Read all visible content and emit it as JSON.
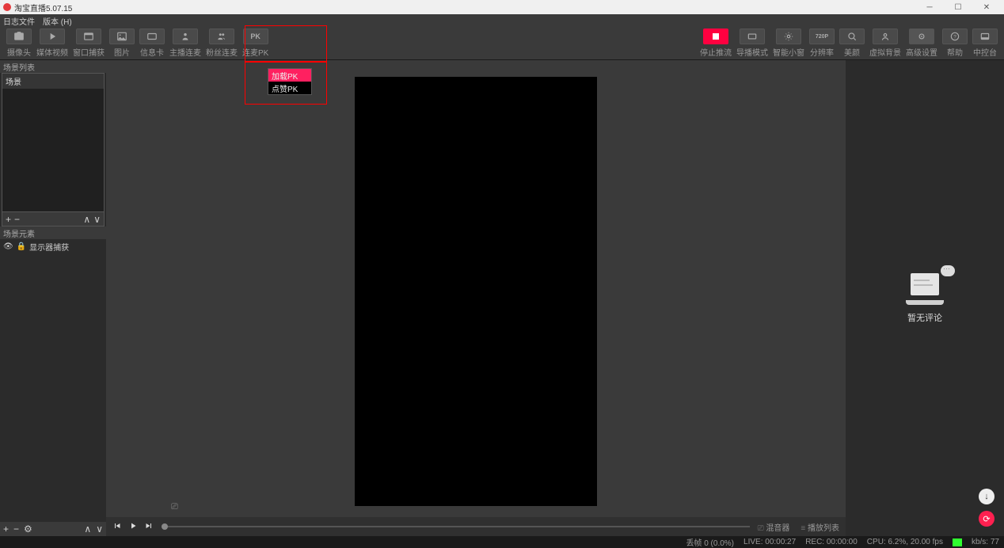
{
  "app": {
    "title": "淘宝直播5.07.15"
  },
  "menu": {
    "log_file": "日志文件",
    "ver_h": "版本 (H)"
  },
  "toolbar_left": [
    {
      "label": "摄像头",
      "icon": "camera"
    },
    {
      "label": "媒体视频",
      "icon": "play"
    },
    {
      "label": "窗口捕获",
      "icon": "window"
    },
    {
      "label": "图片",
      "icon": "image"
    },
    {
      "label": "信息卡",
      "icon": "card"
    },
    {
      "label": "主播连麦",
      "icon": "mic"
    },
    {
      "label": "粉丝连麦",
      "icon": "group"
    },
    {
      "label": "连麦PK",
      "icon": "pk",
      "text": "PK"
    }
  ],
  "pk_dropdown": {
    "item1": "加载PK",
    "item2": "点赞PK"
  },
  "toolbar_right": [
    {
      "label": "停止推流",
      "icon": "stop"
    },
    {
      "label": "导播模式",
      "icon": "director"
    },
    {
      "label": "智能小窗",
      "icon": "pip"
    },
    {
      "label": "分辨率",
      "icon": "720p",
      "text": "720P"
    },
    {
      "label": "美颜",
      "icon": "beauty"
    },
    {
      "label": "虚拟背景",
      "icon": "vbg"
    },
    {
      "label": "高级设置",
      "icon": "settings"
    },
    {
      "label": "帮助",
      "icon": "help"
    },
    {
      "label": "中控台",
      "icon": "console"
    }
  ],
  "panels": {
    "scene_list_header": "场景列表",
    "scene_name": "场景",
    "element_header": "场景元素",
    "element_display_capture": "显示器捕获"
  },
  "comment": {
    "empty_text": "暂无评论"
  },
  "playback_right": {
    "mixer": "混音器",
    "playlist": "播放列表"
  },
  "status": {
    "dropped": "丢帧 0 (0.0%)",
    "live": "LIVE: 00:00:27",
    "rec": "REC: 00:00:00",
    "cpu": "CPU: 6.2%, 20.00 fps",
    "kbs": "kb/s: 77"
  }
}
